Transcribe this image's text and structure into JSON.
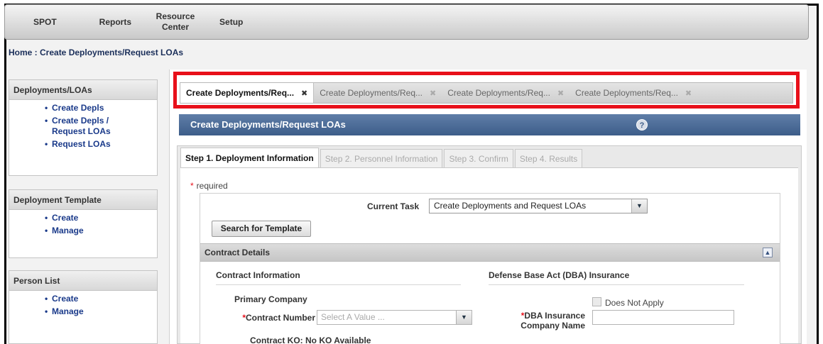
{
  "topnav": {
    "items": [
      "SPOT",
      "Reports",
      "Resource Center",
      "Setup"
    ]
  },
  "breadcrumb": "Home : Create Deployments/Request LOAs",
  "sidebar": {
    "deployments": {
      "title": "Deployments/LOAs",
      "items": [
        "Create Depls",
        "Create Depls / Request LOAs",
        "Request LOAs"
      ]
    },
    "template": {
      "title": "Deployment Template",
      "items": [
        "Create",
        "Manage"
      ]
    },
    "person": {
      "title": "Person List",
      "items": [
        "Create",
        "Manage"
      ]
    }
  },
  "doc_tabs": [
    {
      "label": "Create Deployments/Req...",
      "active": true
    },
    {
      "label": "Create Deployments/Req...",
      "active": false
    },
    {
      "label": "Create Deployments/Req...",
      "active": false
    },
    {
      "label": "Create Deployments/Req...",
      "active": false
    }
  ],
  "panel": {
    "title": "Create Deployments/Request LOAs",
    "help_glyph": "?"
  },
  "steps": [
    {
      "label": "Step 1. Deployment Information",
      "active": true
    },
    {
      "label": "Step 2. Personnel Information",
      "active": false
    },
    {
      "label": "Step 3. Confirm",
      "active": false
    },
    {
      "label": "Step 4. Results",
      "active": false
    }
  ],
  "form": {
    "required_note": "required",
    "current_task_label": "Current Task",
    "current_task_value": "Create Deployments and Request LOAs",
    "search_button": "Search for Template",
    "section_title": "Contract Details",
    "contract_info_head": "Contract Information",
    "dba_head": "Defense Base Act (DBA) Insurance",
    "primary_company_label": "Primary Company",
    "contract_number_label": "Contract Number",
    "contract_number_placeholder": "Select A Value ...",
    "does_not_apply_label": "Does Not Apply",
    "dba_company_label": "DBA Insurance Company Name",
    "contract_ko_cut": "Contract KO: No KO Available"
  },
  "colors": {
    "highlight_border": "#e8101a",
    "panel_header": "#3d5d89",
    "link": "#1a3a8a"
  }
}
